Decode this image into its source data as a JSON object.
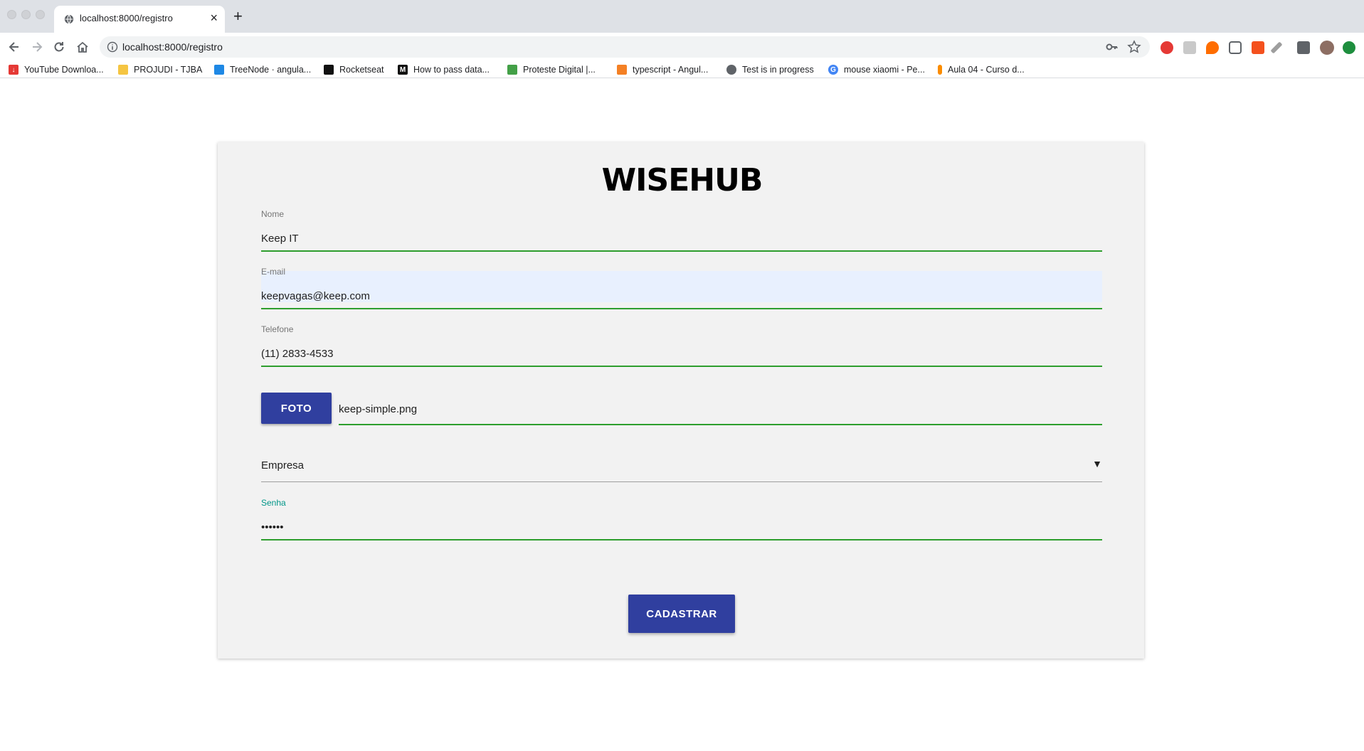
{
  "browser": {
    "tab_title": "localhost:8000/registro",
    "url": "localhost:8000/registro",
    "bookmarks": [
      {
        "label": "YouTube Downloa...",
        "icon": "youtube-downloader-icon",
        "color": "#e53935"
      },
      {
        "label": "PROJUDI - TJBA",
        "icon": "scales-icon",
        "color": "#f5c542"
      },
      {
        "label": "TreeNode · angula...",
        "icon": "book-icon",
        "color": "#1e88e5"
      },
      {
        "label": "Rocketseat",
        "icon": "rocketseat-icon",
        "color": "#111111"
      },
      {
        "label": "How to pass data...",
        "icon": "medium-icon",
        "color": "#111111"
      },
      {
        "label": "Proteste Digital |...",
        "icon": "proteste-icon",
        "color": "#43a047"
      },
      {
        "label": "typescript - Angul...",
        "icon": "stackoverflow-icon",
        "color": "#f48024"
      },
      {
        "label": "Test is in progress",
        "icon": "globe-icon",
        "color": "#5f6368"
      },
      {
        "label": "mouse xiaomi - Pe...",
        "icon": "google-icon",
        "color": "#4285f4"
      },
      {
        "label": "Aula 04 - Curso d...",
        "icon": "flame-icon",
        "color": "#fb8c00"
      }
    ]
  },
  "form": {
    "logo": "WISEHUB",
    "nome": {
      "label": "Nome",
      "value": "Keep IT"
    },
    "email": {
      "label": "E-mail",
      "value": "keepvagas@keep.com"
    },
    "telefone": {
      "label": "Telefone",
      "value": "(11) 2833-4533"
    },
    "foto": {
      "button": "FOTO",
      "filename": "keep-simple.png"
    },
    "tipo": {
      "value": "Empresa"
    },
    "senha": {
      "label": "Senha",
      "value": "••••••"
    },
    "submit": "CADASTRAR"
  },
  "colors": {
    "primary": "#303f9f",
    "valid_line": "#2e9e2e",
    "focus_label": "#009688"
  }
}
